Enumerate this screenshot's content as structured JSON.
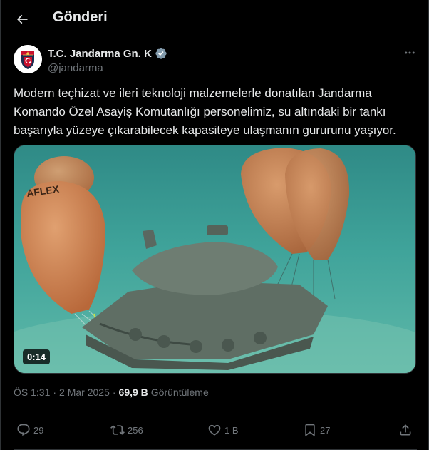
{
  "header": {
    "title": "Gönderi",
    "back_icon": "arrow-left-icon"
  },
  "author": {
    "display_name": "T.C. Jandarma Gn. K",
    "handle": "@jandarma",
    "verified": true,
    "verified_color": "#829aab",
    "avatar_icon": "jandarma-emblem"
  },
  "tweet": {
    "text": "Modern teçhizat ve ileri teknoloji malzemelerle donatılan Jandarma Komando Özel Asayiş Komutanlığı personelimiz, su altındaki bir tankı başarıyla yüzeye çıkarabilecek kapasiteye ulaşmanın gururunu yaşıyor.",
    "media": {
      "type": "video",
      "duration": "0:14",
      "balloon_label": "AFLEX"
    }
  },
  "meta": {
    "time": "ÖS 1:31",
    "separator": "·",
    "date": "2 Mar 2025",
    "views_count": "69,9 B",
    "views_label": "Görüntüleme"
  },
  "actions": {
    "replies": "29",
    "retweets": "256",
    "likes": "1 B",
    "bookmarks": "27"
  },
  "colors": {
    "background": "#000000",
    "text_primary": "#e7e9ea",
    "text_secondary": "#71767b",
    "border": "#2f3336"
  }
}
